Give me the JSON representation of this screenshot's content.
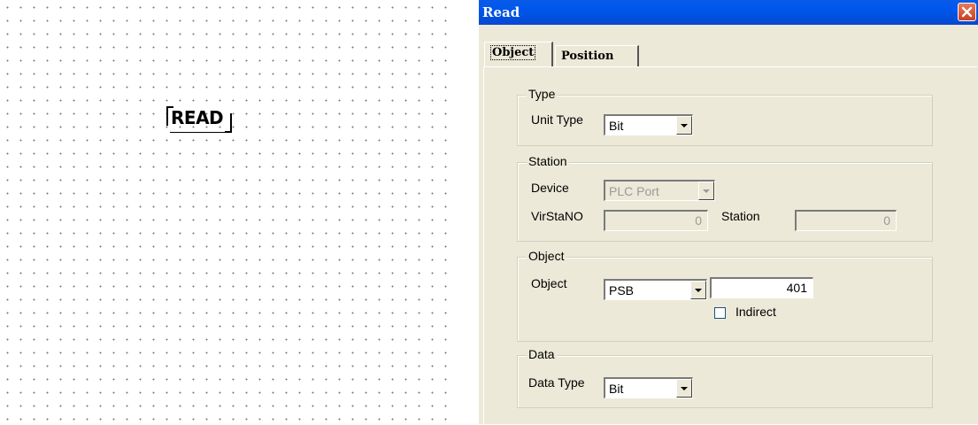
{
  "canvas": {
    "block_label": "READ"
  },
  "dialog": {
    "title": "Read",
    "tabs": [
      {
        "label": "Object",
        "active": true
      },
      {
        "label": "Position",
        "active": false
      }
    ],
    "type_group": {
      "legend": "Type",
      "unit_type_label": "Unit Type",
      "unit_type_value": "Bit"
    },
    "station_group": {
      "legend": "Station",
      "device_label": "Device",
      "device_value": "PLC Port",
      "virstano_label": "VirStaNO",
      "virstano_value": "0",
      "station_label": "Station",
      "station_value": "0"
    },
    "object_group": {
      "legend": "Object",
      "object_label": "Object",
      "object_type_value": "PSB",
      "object_address_value": "401",
      "indirect_label": "Indirect",
      "indirect_checked": false
    },
    "data_group": {
      "legend": "Data",
      "data_type_label": "Data Type",
      "data_type_value": "Bit"
    }
  },
  "colors": {
    "titlebar": "#0058ee",
    "dialog_bg": "#ece9d8",
    "close_button": "#d9532f"
  }
}
